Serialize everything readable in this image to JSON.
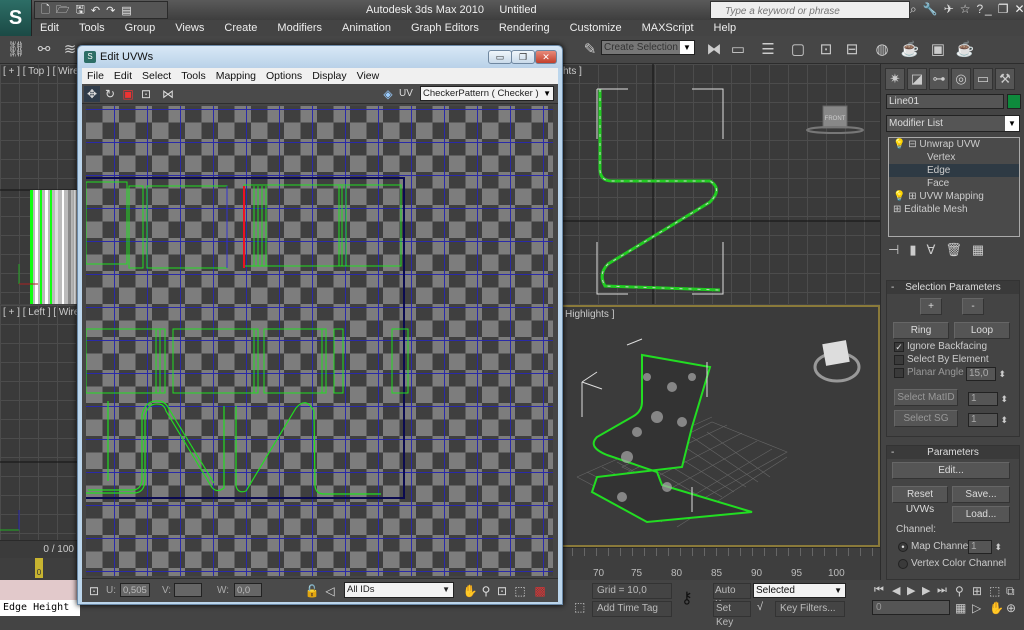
{
  "app": {
    "title": "Autodesk 3ds Max  2010",
    "document": "Untitled",
    "logo_icon": "3dsmax-logo-icon",
    "search_placeholder": "Type a keyword or phrase",
    "window_controls": [
      "minimize",
      "restore",
      "close"
    ]
  },
  "quick_access": [
    "new-file-icon",
    "open-file-icon",
    "save-icon",
    "undo-icon",
    "redo-icon",
    "project-folder-icon"
  ],
  "menu": [
    "Edit",
    "Tools",
    "Group",
    "Views",
    "Create",
    "Modifiers",
    "Animation",
    "Graph Editors",
    "Rendering",
    "Customize",
    "MAXScript",
    "Help"
  ],
  "toolbar": {
    "selection_set_placeholder": "Create Selection Se",
    "icons": [
      "link-icon",
      "unlink-icon",
      "bind-spacewarp-icon",
      "edit-named-selection-icon",
      "mirror-icon",
      "align-icon",
      "layer-manager-icon",
      "curve-editor-icon",
      "schematic-view-icon",
      "material-editor-icon",
      "render-setup-icon",
      "rendered-frame-icon",
      "render-icon"
    ]
  },
  "viewports": {
    "top": "[ + ] [ Top ] [ Wirefr",
    "left": "[ + ] [ Left ] [ Wirefr",
    "front": "hts ]",
    "perspective": "Highlights ]",
    "front_viewcube": "FRONT"
  },
  "uvw_editor": {
    "title": "Edit UVWs",
    "menu": [
      "File",
      "Edit",
      "Select",
      "Tools",
      "Mapping",
      "Options",
      "Display",
      "View"
    ],
    "tools": [
      "move-icon",
      "rotate-icon",
      "scale-icon",
      "freeform-icon",
      "mirror-icon"
    ],
    "texture": "CheckerPattern  ( Checker )",
    "u_label": "U:",
    "u_value": "0,505",
    "v_label": "V:",
    "v_value": "",
    "w_label": "W:",
    "w_value": "0,0",
    "ids": "All IDs"
  },
  "command_panel": {
    "tabs": [
      "create-icon",
      "modify-icon",
      "hierarchy-icon",
      "motion-icon",
      "display-icon",
      "utilities-icon"
    ],
    "object_name": "Line01",
    "object_color": "#0e8a3c",
    "modifier_list": "Modifier List",
    "stack": [
      {
        "label": "Unwrap UVW",
        "level": 0,
        "expanded": true
      },
      {
        "label": "Vertex",
        "level": 1
      },
      {
        "label": "Edge",
        "level": 1,
        "selected": true
      },
      {
        "label": "Face",
        "level": 1
      },
      {
        "label": "UVW Mapping",
        "level": 0
      },
      {
        "label": "Editable Mesh",
        "level": 0
      }
    ],
    "selection_parameters": {
      "title": "Selection Parameters",
      "grow": "+",
      "shrink": "-",
      "ring": "Ring",
      "loop": "Loop",
      "ignore_backfacing": {
        "label": "Ignore Backfacing",
        "checked": true
      },
      "select_by_element": {
        "label": "Select By Element",
        "checked": false
      },
      "planar_angle": {
        "label": "Planar Angle",
        "checked": false,
        "value": "15,0"
      },
      "select_matid": "Select MatID",
      "matid_value": "1",
      "select_sg": "Select SG",
      "sg_value": "1"
    },
    "parameters": {
      "title": "Parameters",
      "edit": "Edit...",
      "reset": "Reset UVWs",
      "save": "Save...",
      "load": "Load...",
      "channel_group": "Channel:",
      "map_channel": {
        "label": "Map Channel:",
        "selected": true,
        "value": "1"
      },
      "vertex_color_channel": {
        "label": "Vertex Color Channel",
        "selected": false
      }
    }
  },
  "timeline": {
    "frame_counter": "0 / 100",
    "current_frame_marker": "0",
    "ruler_ticks": [
      "70",
      "75",
      "80",
      "85",
      "90",
      "95",
      "100"
    ],
    "grid": "Grid = 10,0",
    "add_time_tag": "Add Time Tag",
    "auto_key": "Auto Key",
    "set_key": "Set Key",
    "key_mode": "Selected",
    "key_filters": "Key Filters...",
    "frame": "0"
  },
  "maxscript_listener": "Edge Height"
}
